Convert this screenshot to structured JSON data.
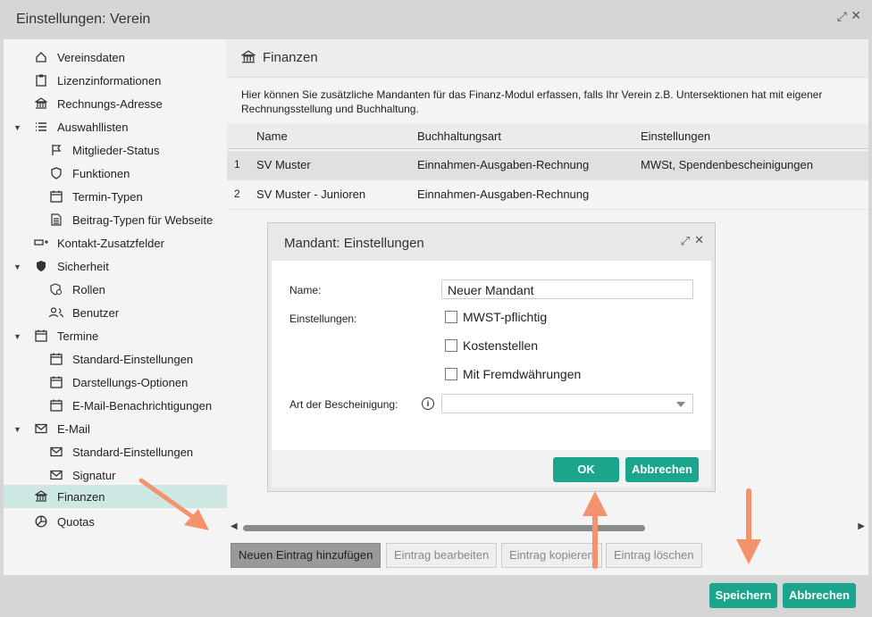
{
  "window": {
    "title": "Einstellungen: Verein"
  },
  "sidebar": {
    "items": [
      {
        "label": "Vereinsdaten",
        "icon": "home-icon"
      },
      {
        "label": "Lizenzinformationen",
        "icon": "clipboard-icon"
      },
      {
        "label": "Rechnungs-Adresse",
        "icon": "bank-icon"
      },
      {
        "label": "Auswahllisten",
        "icon": "list-icon"
      },
      {
        "label": "Mitglieder-Status",
        "icon": "flag-icon"
      },
      {
        "label": "Funktionen",
        "icon": "shield-outline-icon"
      },
      {
        "label": "Termin-Typen",
        "icon": "calendar-icon"
      },
      {
        "label": "Beitrag-Typen für Webseite",
        "icon": "document-icon"
      },
      {
        "label": "Kontakt-Zusatzfelder",
        "icon": "field-add-icon"
      },
      {
        "label": "Sicherheit",
        "icon": "shield-icon"
      },
      {
        "label": "Rollen",
        "icon": "gear-shield-icon"
      },
      {
        "label": "Benutzer",
        "icon": "users-icon"
      },
      {
        "label": "Termine",
        "icon": "calendar-icon"
      },
      {
        "label": "Standard-Einstellungen",
        "icon": "calendar-icon"
      },
      {
        "label": "Darstellungs-Optionen",
        "icon": "calendar-icon"
      },
      {
        "label": "E-Mail-Benachrichtigungen",
        "icon": "calendar-icon"
      },
      {
        "label": "E-Mail",
        "icon": "mail-icon"
      },
      {
        "label": "Standard-Einstellungen",
        "icon": "mail-icon"
      },
      {
        "label": "Signatur",
        "icon": "mail-icon"
      },
      {
        "label": "Finanzen",
        "icon": "bank-icon"
      },
      {
        "label": "Quotas",
        "icon": "pie-chart-icon"
      }
    ]
  },
  "main": {
    "title": "Finanzen",
    "description": "Hier können Sie zusätzliche Mandanten für das Finanz-Modul erfassen, falls Ihr Verein z.B. Untersektionen hat mit eigener Rechnungsstellung und Buchhaltung.",
    "columns": [
      "Name",
      "Buchhaltungsart",
      "Einstellungen"
    ],
    "rows": [
      {
        "num": "1",
        "name": "SV Muster",
        "art": "Einnahmen-Ausgaben-Rechnung",
        "settings": "MWSt, Spendenbescheinigungen"
      },
      {
        "num": "2",
        "name": "SV Muster - Junioren",
        "art": "Einnahmen-Ausgaben-Rechnung",
        "settings": ""
      }
    ],
    "buttons": {
      "new": "Neuen Eintrag hinzufügen",
      "edit": "Eintrag bearbeiten",
      "copy": "Eintrag kopieren",
      "delete": "Eintrag löschen"
    }
  },
  "modal": {
    "title": "Mandant: Einstellungen",
    "name_label": "Name:",
    "name_value": "Neuer Mandant",
    "settings_label": "Einstellungen:",
    "options": [
      "MWST-pflichtig",
      "Kostenstellen",
      "Mit Fremdwährungen"
    ],
    "cert_label": "Art der Bescheinigung:",
    "cert_value": "",
    "ok": "OK",
    "cancel": "Abbrechen"
  },
  "footer": {
    "save": "Speichern",
    "cancel": "Abbrechen"
  },
  "colors": {
    "accent": "#1aa58c",
    "annotation_arrow": "#f4926b"
  }
}
